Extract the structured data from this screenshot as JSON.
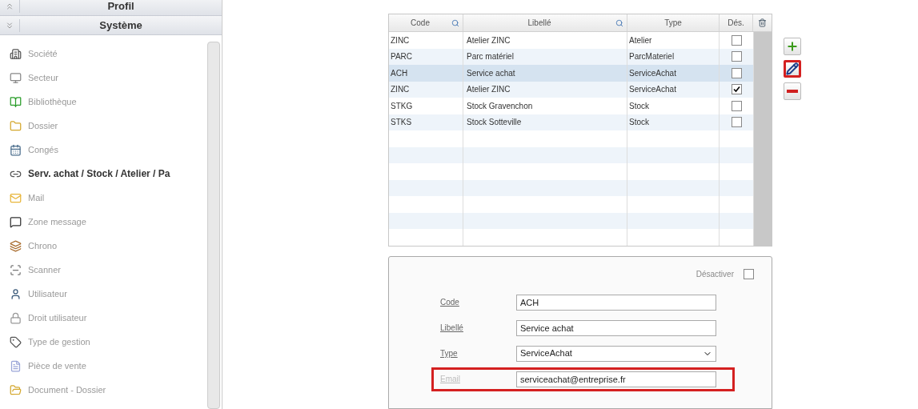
{
  "sidebar": {
    "sections": [
      {
        "title": "Profil",
        "expanded": false
      },
      {
        "title": "Système",
        "expanded": true
      }
    ],
    "items": [
      {
        "label": "Société",
        "selected": false
      },
      {
        "label": "Secteur",
        "selected": false
      },
      {
        "label": "Bibliothèque",
        "selected": false
      },
      {
        "label": "Dossier",
        "selected": false
      },
      {
        "label": "Congés",
        "selected": false
      },
      {
        "label": "Serv. achat / Stock / Atelier / Pa",
        "selected": true
      },
      {
        "label": "Mail",
        "selected": false
      },
      {
        "label": "Zone message",
        "selected": false
      },
      {
        "label": "Chrono",
        "selected": false
      },
      {
        "label": "Scanner",
        "selected": false
      },
      {
        "label": "Utilisateur",
        "selected": false
      },
      {
        "label": "Droit utilisateur",
        "selected": false
      },
      {
        "label": "Type de gestion",
        "selected": false
      },
      {
        "label": "Pièce de vente",
        "selected": false
      },
      {
        "label": "Document - Dossier",
        "selected": false
      }
    ]
  },
  "table": {
    "columns": [
      {
        "label": "Code",
        "searchable": true
      },
      {
        "label": "Libellé",
        "searchable": true
      },
      {
        "label": "Type",
        "searchable": false
      },
      {
        "label": "Dés.",
        "searchable": false
      }
    ],
    "rows": [
      {
        "code": "ZINC",
        "libelle": "Atelier ZINC",
        "type": "Atelier",
        "disabled": false,
        "selected": false
      },
      {
        "code": "PARC",
        "libelle": "Parc matériel",
        "type": "ParcMateriel",
        "disabled": false,
        "selected": false
      },
      {
        "code": "ACH",
        "libelle": "Service achat",
        "type": "ServiceAchat",
        "disabled": false,
        "selected": true
      },
      {
        "code": "ZINC",
        "libelle": "Atelier ZINC",
        "type": "ServiceAchat",
        "disabled": true,
        "selected": false
      },
      {
        "code": "STKG",
        "libelle": "Stock Gravenchon",
        "type": "Stock",
        "disabled": false,
        "selected": false
      },
      {
        "code": "STKS",
        "libelle": "Stock Sotteville",
        "type": "Stock",
        "disabled": false,
        "selected": false
      }
    ]
  },
  "actions": [
    {
      "kind": "add",
      "highlighted": false
    },
    {
      "kind": "edit",
      "highlighted": true
    },
    {
      "kind": "remove",
      "highlighted": false
    }
  ],
  "form": {
    "deactivate": {
      "label": "Désactiver",
      "checked": false
    },
    "fields": [
      {
        "kind": "text",
        "label": "Code",
        "value": "ACH",
        "enabled": true,
        "highlighted": false
      },
      {
        "kind": "text",
        "label": "Libellé",
        "value": "Service achat",
        "enabled": true,
        "highlighted": false
      },
      {
        "kind": "select",
        "label": "Type",
        "value": "ServiceAchat",
        "enabled": true,
        "highlighted": false
      },
      {
        "kind": "text",
        "label": "Email",
        "value": "serviceachat@entreprise.fr",
        "enabled": false,
        "highlighted": true
      }
    ]
  }
}
